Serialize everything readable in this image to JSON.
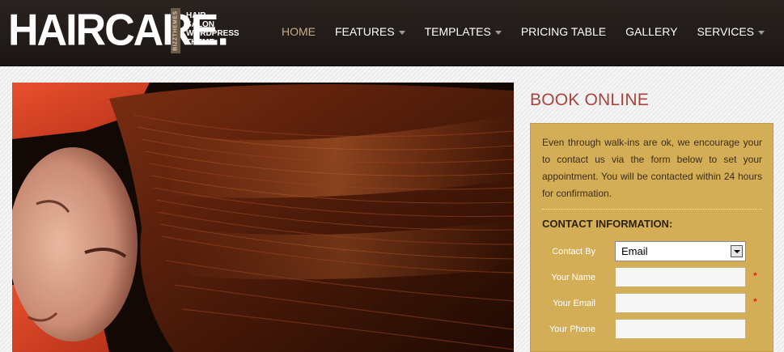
{
  "header": {
    "logo": "HAIRCARE.",
    "logo_vertical": "BIZZTHEMES",
    "tagline": [
      "HAIR",
      "SALON",
      "WORDPRESS",
      "THEME"
    ]
  },
  "nav": {
    "items": [
      {
        "label": "HOME",
        "active": true,
        "dropdown": false
      },
      {
        "label": "FEATURES",
        "active": false,
        "dropdown": true
      },
      {
        "label": "TEMPLATES",
        "active": false,
        "dropdown": true
      },
      {
        "label": "PRICING TABLE",
        "active": false,
        "dropdown": false
      },
      {
        "label": "GALLERY",
        "active": false,
        "dropdown": false
      },
      {
        "label": "SERVICES",
        "active": false,
        "dropdown": true
      }
    ]
  },
  "sidebar": {
    "title": "BOOK ONLINE",
    "intro": "Even through walk-ins are ok, we encourage your to contact us via the form below to set your appointment. You will be contacted within 24 hours for confirmation.",
    "section_heading": "CONTACT INFORMATION:",
    "form": {
      "contact_by_label": "Contact By",
      "contact_by_value": "Email",
      "name_label": "Your Name",
      "name_value": "",
      "email_label": "Your Email",
      "email_value": "",
      "phone_label": "Your Phone",
      "phone_value": "",
      "required_mark": "*"
    }
  },
  "colors": {
    "header_bg": "#221c1a",
    "nav_active": "#c8ac86",
    "title_red": "#a8443b",
    "panel_gold": "#d4ae57",
    "required_red": "#d42a1a"
  }
}
